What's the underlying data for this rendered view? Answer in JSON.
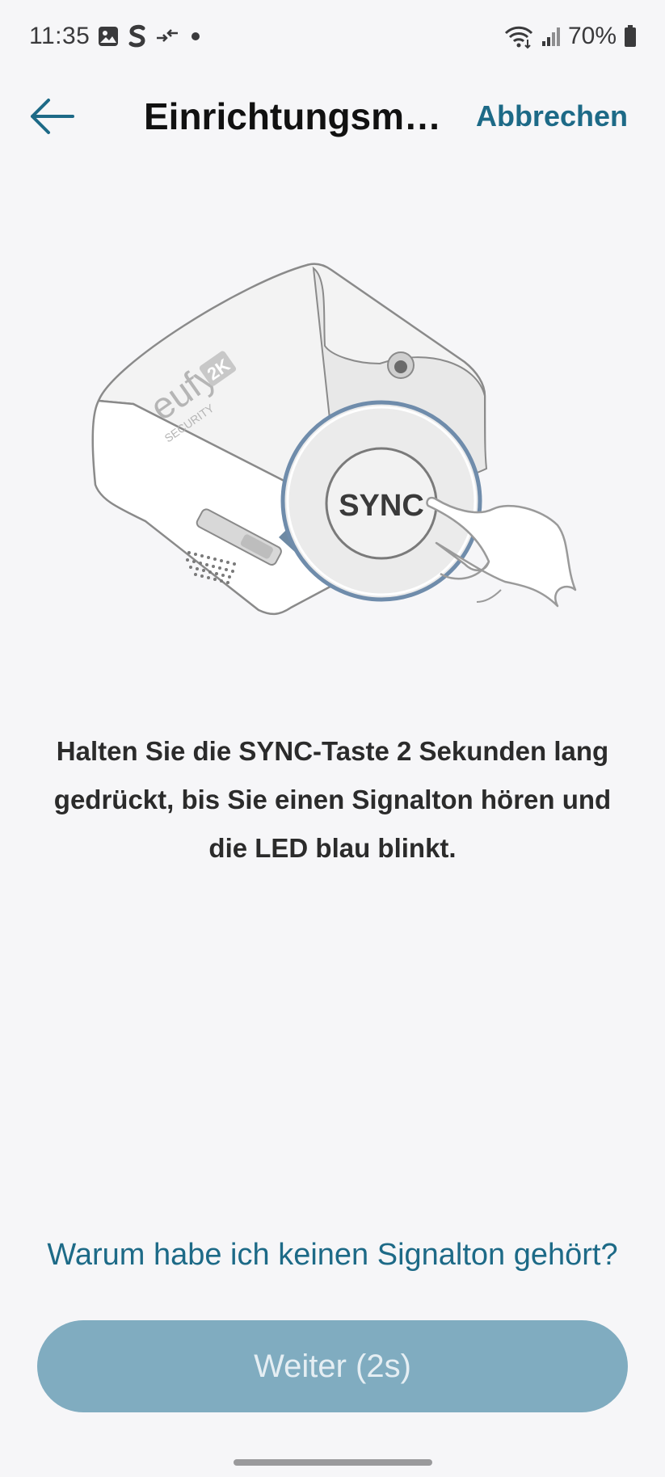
{
  "status_bar": {
    "time": "11:35",
    "battery": "70%",
    "left_icons": [
      "image-icon",
      "s-app-icon",
      "transfer-icon",
      "dot-icon"
    ],
    "right_icons": [
      "wifi-icon",
      "signal-icon",
      "battery-icon"
    ]
  },
  "header": {
    "title": "Einrichtungsmodus",
    "cancel_label": "Abbrechen",
    "back_icon": "arrow-left-icon"
  },
  "illustration": {
    "brand": "eufy",
    "badge": "2K",
    "subbrand": "SECURITY",
    "button_label": "SYNC"
  },
  "instruction": "Halten Sie die SYNC-Taste 2 Sekunden lang gedrückt, bis Sie einen Signalton hören und die LED blau blinkt.",
  "help_link": "Warum habe ich keinen Signalton gehört?",
  "next_button": {
    "label": "Weiter (2s)",
    "enabled": false
  },
  "colors": {
    "accent": "#1d6a87",
    "button_disabled": "#80acc0",
    "background": "#f6f6f8"
  }
}
